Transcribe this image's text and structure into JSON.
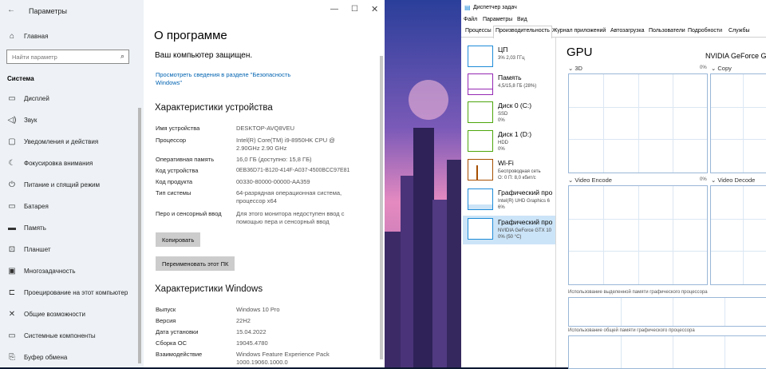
{
  "settings": {
    "window_title": "Параметры",
    "sidebar": {
      "home": "Главная",
      "search_placeholder": "Найти параметр",
      "section": "Система",
      "items": [
        {
          "label": "Дисплей"
        },
        {
          "label": "Звук"
        },
        {
          "label": "Уведомления и действия"
        },
        {
          "label": "Фокусировка внимания"
        },
        {
          "label": "Питание и спящий режим"
        },
        {
          "label": "Батарея"
        },
        {
          "label": "Память"
        },
        {
          "label": "Планшет"
        },
        {
          "label": "Многозадачность"
        },
        {
          "label": "Проецирование на этот компьютер"
        },
        {
          "label": "Общие возможности"
        },
        {
          "label": "Системные компоненты"
        },
        {
          "label": "Буфер обмена"
        }
      ]
    },
    "main": {
      "page_title": "О программе",
      "protected": "Ваш компьютер защищен.",
      "security_link": "Просмотреть сведения в разделе \"Безопасность Windows\"",
      "device_specs_title": "Характеристики устройства",
      "device_specs": [
        {
          "label": "Имя устройства",
          "value": "DESKTOP-AVQ8VEU"
        },
        {
          "label": "Процессор",
          "value": "Intel(R) Core(TM) i9-8950HK CPU @ 2.90GHz   2.90 GHz"
        },
        {
          "label": "Оперативная память",
          "value": "16,0 ГБ (доступно: 15,8 ГБ)"
        },
        {
          "label": "Код устройства",
          "value": "0EB36D71-B120-414F-A037-4500BCC97E81"
        },
        {
          "label": "Код продукта",
          "value": "00330-80000-00000-AA359"
        },
        {
          "label": "Тип системы",
          "value": "64-разрядная операционная система, процессор x64"
        },
        {
          "label": "Перо и сенсорный ввод",
          "value": "Для этого монитора недоступен ввод с помощью пера и сенсорный ввод"
        }
      ],
      "copy_button": "Копировать",
      "rename_button": "Переименовать этот ПК",
      "win_specs_title": "Характеристики Windows",
      "win_specs": [
        {
          "label": "Выпуск",
          "value": "Windows 10 Pro"
        },
        {
          "label": "Версия",
          "value": "22H2"
        },
        {
          "label": "Дата установки",
          "value": "15.04.2022"
        },
        {
          "label": "Сборка ОС",
          "value": "19045.4780"
        },
        {
          "label": "Взаимодействие",
          "value": "Windows Feature Experience Pack 1000.19060.1000.0"
        }
      ]
    }
  },
  "taskmgr": {
    "window_title": "Диспетчер задач",
    "menu": [
      "Файл",
      "Параметры",
      "Вид"
    ],
    "tabs": [
      "Процессы",
      "Производительность",
      "Журнал приложений",
      "Автозагрузка",
      "Пользователи",
      "Подробности",
      "Службы"
    ],
    "active_tab": "Производительность",
    "perf_items": [
      {
        "title": "ЦП",
        "sub1": "3% 2,03 ГГц",
        "sub2": "",
        "sub3": "",
        "color": "#1e8bd8"
      },
      {
        "title": "Память",
        "sub1": "4,5/15,8 ГБ (28%)",
        "sub2": "",
        "sub3": "",
        "color": "#9528b4"
      },
      {
        "title": "Диск 0 (C:)",
        "sub1": "SSD",
        "sub2": "0%",
        "sub3": "",
        "color": "#4da60c"
      },
      {
        "title": "Диск 1 (D:)",
        "sub1": "HDD",
        "sub2": "0%",
        "sub3": "",
        "color": "#4da60c"
      },
      {
        "title": "Wi-Fi",
        "sub1": "Беспроводная сеть",
        "sub2": "О: 0 П: 8,0 кбит/с",
        "sub3": "",
        "color": "#a74f01"
      },
      {
        "title": "Графический про",
        "sub1": "Intel(R) UHD Graphics 6",
        "sub2": "6%",
        "sub3": "",
        "color": "#1e8bd8"
      },
      {
        "title": "Графический про",
        "sub1": "NVIDIA GeForce GTX 10",
        "sub2": "0% (50 °C)",
        "sub3": "",
        "color": "#1e8bd8"
      }
    ],
    "gpu": {
      "title": "GPU",
      "name": "NVIDIA GeForce GT",
      "engines": [
        "3D",
        "Copy",
        "Video Encode",
        "Video Decode"
      ],
      "pct_label": "0%",
      "dedicated_mem": "Использование выделенной памяти графического процессора",
      "shared_mem": "Использование общей памяти графического процессора"
    }
  }
}
